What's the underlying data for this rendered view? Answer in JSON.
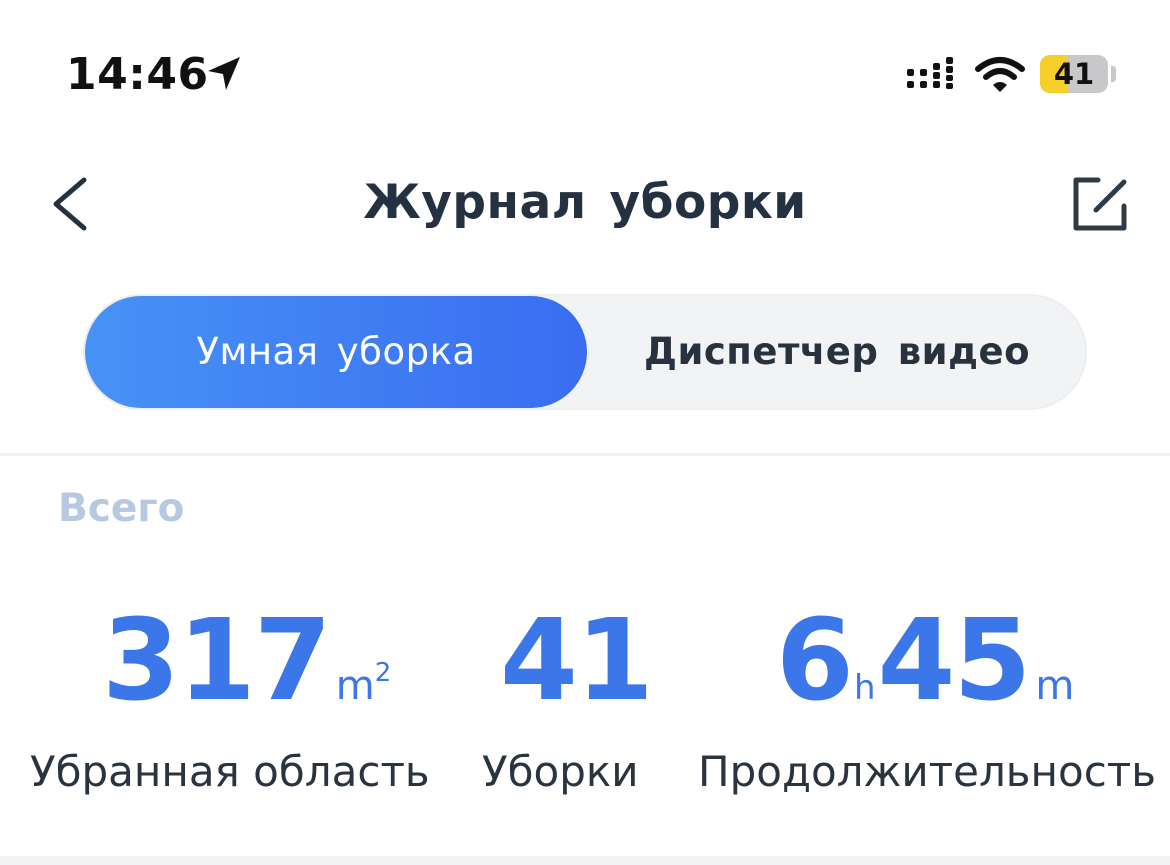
{
  "status_bar": {
    "time": "14:46",
    "battery_level": "41",
    "battery_fraction": 0.41,
    "battery_color": "#f7cf2a"
  },
  "nav": {
    "title": "Журнал уборки",
    "back_icon": "chevron-left-icon",
    "edit_icon": "edit-icon"
  },
  "tabs": [
    {
      "label": "Умная уборка",
      "active": true
    },
    {
      "label": "Диспетчер видео",
      "active": false
    }
  ],
  "summary": {
    "section_label": "Всего",
    "area": {
      "value": "317",
      "unit": "m",
      "unit_sup": "2",
      "label": "Убранная область"
    },
    "cleanings": {
      "value": "41",
      "label": "Уборки"
    },
    "duration": {
      "hours": "6",
      "hours_unit": "h",
      "minutes": "45",
      "minutes_unit": "m",
      "label": "Продолжительность"
    }
  },
  "colors": {
    "accent": "#3c77ea",
    "title": "#233140",
    "section_label": "#b7c9e0"
  }
}
